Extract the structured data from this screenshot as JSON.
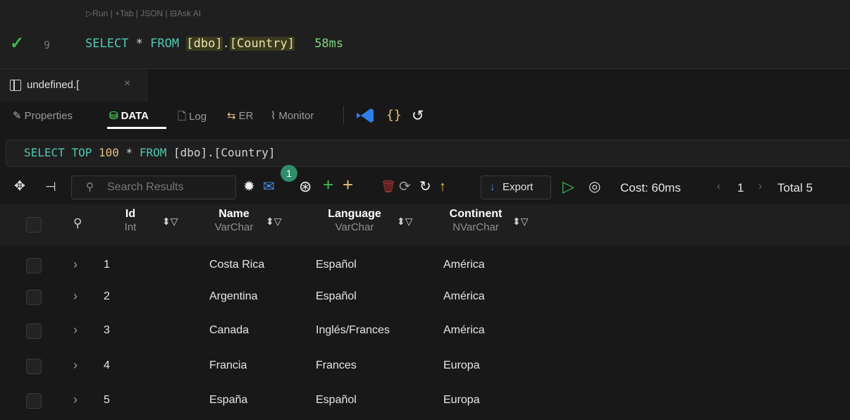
{
  "editor": {
    "codelens": "▷Run | +Tab | JSON | ⊟Ask AI",
    "line_number": "9",
    "code": {
      "select": "SELECT",
      "star": "*",
      "from": "FROM",
      "schema": "[dbo]",
      "dot": ".",
      "table": "[Country]"
    },
    "timing": "58ms"
  },
  "tab": {
    "label": "undefined.[",
    "close": "×"
  },
  "panel_tabs": [
    {
      "icon": "✎",
      "label": "Properties"
    },
    {
      "icon": "⛁",
      "label": "DATA"
    },
    {
      "icon": "🗋",
      "label": "Log"
    },
    {
      "icon": "⇆",
      "label": "ER"
    },
    {
      "icon": "⌇",
      "label": "Monitor"
    }
  ],
  "panel_icons": [
    "vscode-icon",
    "braces-icon",
    "history-icon"
  ],
  "query": {
    "select": "SELECT",
    "top": "TOP",
    "limit": "100",
    "star": "*",
    "from": "FROM",
    "target": "[dbo].[Country]"
  },
  "toolbar": {
    "search_placeholder": "Search Results",
    "badge": "1",
    "export_label": "Export",
    "cost": "Cost: 60ms",
    "page": "1",
    "total": "Total 5"
  },
  "columns": [
    {
      "name": "Id",
      "type": "Int"
    },
    {
      "name": "Name",
      "type": "VarChar"
    },
    {
      "name": "Language",
      "type": "VarChar"
    },
    {
      "name": "Continent",
      "type": "NVarChar"
    }
  ],
  "rows": [
    {
      "id": "1",
      "name": "Costa Rica",
      "language": "Español",
      "continent": "América"
    },
    {
      "id": "2",
      "name": "Argentina",
      "language": "Español",
      "continent": "América"
    },
    {
      "id": "3",
      "name": "Canada",
      "language": "Inglés/Frances",
      "continent": "América"
    },
    {
      "id": "4",
      "name": "Francia",
      "language": "Frances",
      "continent": "Europa"
    },
    {
      "id": "5",
      "name": "España",
      "language": "Español",
      "continent": "Europa"
    }
  ],
  "colors": {
    "success": "#3fb950",
    "keyword": "#4ec9b0",
    "number": "#e5c07b",
    "add": "#3fb950",
    "add_alt": "#e5c07b",
    "delete": "#c0392b",
    "vscode": "#2f80ed"
  }
}
